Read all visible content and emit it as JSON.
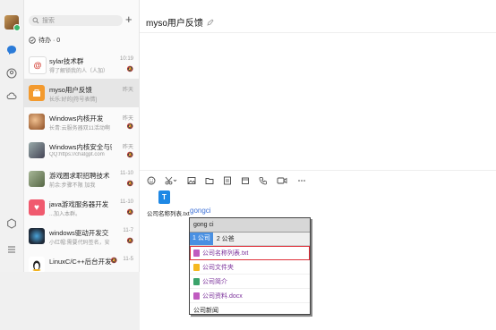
{
  "search": {
    "placeholder": "搜索",
    "add": "+"
  },
  "todo": {
    "label": "待办 · 0"
  },
  "sessions": [
    {
      "name": "sylar技术群",
      "preview": "得了解锁我的人（人加）",
      "time": "10:19",
      "color": "#ffffff",
      "mark": "#d23a2e"
    },
    {
      "name": "myso用户反馈",
      "preview": "长乐:好的[符号表情]",
      "time": "昨天",
      "color": "#f39a2e",
      "mark": "#ffffff",
      "selected": true
    },
    {
      "name": "Windows内核开发",
      "preview": "长青:云服务器双11活动啊",
      "time": "昨天",
      "color": "#c98a5c",
      "mark": "#7a3f1c"
    },
    {
      "name": "Windows内核安全与驱",
      "preview": "QQ:https://chatgpt.com",
      "time": "昨天",
      "color": "#7b8a8a",
      "mark": "#333333"
    },
    {
      "name": "游戏圈求职招聘技术",
      "preview": "前余:步骤不限 加我",
      "time": "11-10",
      "color": "#8a9a7a",
      "mark": "#556644"
    },
    {
      "name": "java游戏服务器开发",
      "preview": "...加入本群。",
      "time": "11-10",
      "color": "#f05a6e",
      "mark": "#ffffff"
    },
    {
      "name": "windows驱动开发交",
      "preview": "小红帽:需要代码签名，安",
      "time": "11-7",
      "color": "#1f2b3a",
      "mark": "#4aa3d8"
    },
    {
      "name": "LinuxC/C++后台开发",
      "preview": "",
      "time": "11-5",
      "color": "#ffffff",
      "mark": "#222222"
    }
  ],
  "chat": {
    "title": "myso用户反馈"
  },
  "attachment": {
    "name": "公司名称列表.txt",
    "icon_letter": "T"
  },
  "input": {
    "typed": "gongci"
  },
  "popup": {
    "header": "gong ci",
    "tabs": [
      "1 公司",
      "2 公爸"
    ],
    "rows": [
      {
        "label": "公司名称列表.txt",
        "color": "#c05bc0",
        "highlighted": true
      },
      {
        "label": "公司文件夹",
        "color": "#f5b820"
      },
      {
        "label": "公司简介",
        "color": "#3aa36a"
      },
      {
        "label": "公司资料.docx",
        "color": "#c05bc0"
      },
      {
        "label": "公司新闻",
        "color": "#222222"
      }
    ]
  }
}
